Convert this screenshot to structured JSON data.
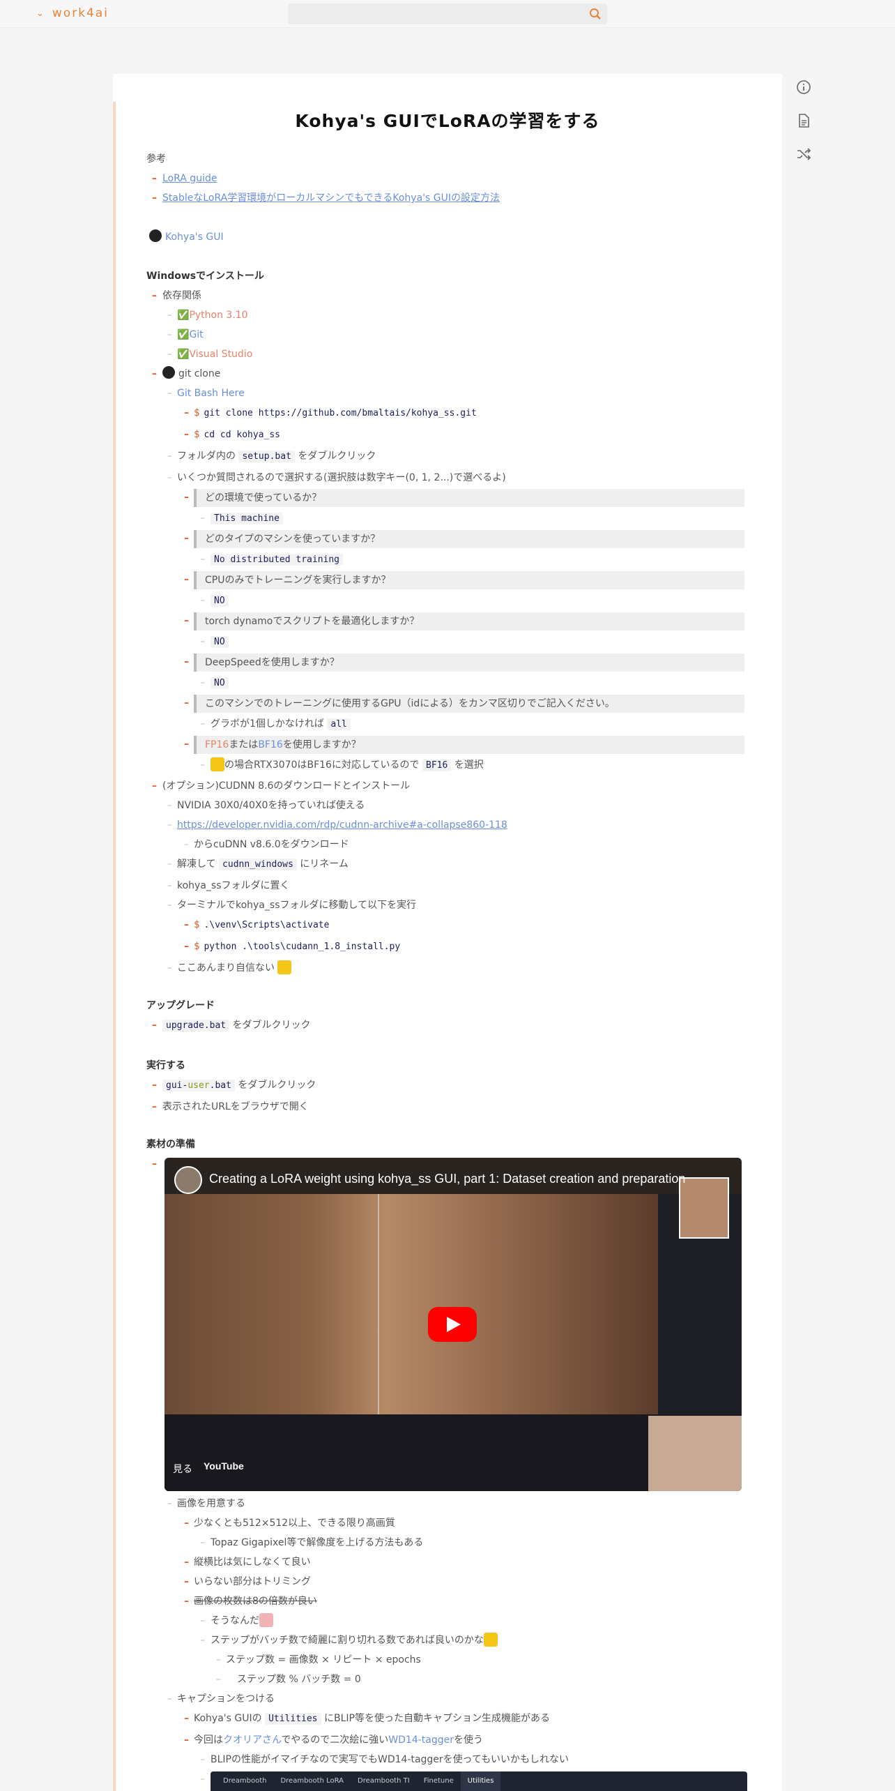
{
  "app": {
    "brand": "work4ai",
    "search_placeholder": ""
  },
  "page": {
    "title": "Kohya's GUIでLoRAの学習をする"
  },
  "refs": {
    "label": "参考",
    "link1": "LoRA guide",
    "link2": "StableなLoRA学習環境がローカルマシンでもできるKohya's GUIの設定方法",
    "github": "Kohya's GUI"
  },
  "install": {
    "heading": "Windowsでインストール",
    "deps": "依存関係",
    "python": "Python 3.10",
    "git": "Git",
    "vs": "Visual Studio",
    "git_clone": "git clone",
    "git_bash": "Git Bash Here",
    "cmd1": "git clone https://github.com/bmaltais/kohya_ss.git",
    "cmd2": "cd cd kohya_ss",
    "setup_pre": "フォルダ内の",
    "setup_code": "setup.bat",
    "setup_post": "をダブルクリック",
    "questions": "いくつか質問されるので選択する(選択肢は数字キー(0, 1, 2...)で選べるよ)",
    "q1": "どの環境で使っているか？",
    "a1": "This machine",
    "q2": "どのタイプのマシンを使っていますか？",
    "a2": "No distributed training",
    "q3": "CPUのみでトレーニングを実行しますか？",
    "a3": "NO",
    "q4": "torch dynamoでスクリプトを最適化しますか？",
    "a4": "NO",
    "q5": "DeepSpeedを使用しますか？",
    "a5": "NO",
    "q6": "このマシンでのトレーニングに使用するGPU（idによる）をカンマ区切りでご記入ください。",
    "a6_pre": "グラボが1個しかなければ",
    "a6_code": "all",
    "q7_fp": "FP16",
    "q7_mid": "または",
    "q7_bf": "BF16",
    "q7_post": "を使用しますか？",
    "a7_pre": "の場合RTX3070はBF16に対応しているので",
    "a7_code": "BF16",
    "a7_post": "を選択",
    "cudnn": "(オプション)CUDNN 8.6のダウンロードとインストール",
    "nvidia": "NVIDIA 30X0/40X0を持っていれば使える",
    "nvidia_link": "https://developer.nvidia.com/rdp/cudnn-archive#a-collapse860-118",
    "cudnn_dl": "からcuDNN v8.6.0をダウンロード",
    "unzip_pre": "解凍して",
    "unzip_code": "cudnn_windows",
    "unzip_post": "にリネーム",
    "place": "kohya_ssフォルダに置く",
    "terminal": "ターミナルでkohya_ssフォルダに移動して以下を実行",
    "cmd3": ".\\venv\\Scripts\\activate",
    "cmd4": "python .\\tools\\cudann_1.8_install.py",
    "unsure": "ここあんまり自信ない"
  },
  "upgrade": {
    "heading": "アップグレード",
    "code": "upgrade.bat",
    "post": "をダブルクリック"
  },
  "run": {
    "heading": "実行する",
    "code_a": "gui-",
    "code_b": "user",
    "code_c": ".bat",
    "post": "をダブルクリック",
    "open": "表示されたURLをブラウザで開く"
  },
  "material": {
    "heading": "素材の準備",
    "video_title": "Creating a LoRA weight using kohya_ss GUI, part 1: Dataset creation and preparation",
    "watch": "見る",
    "youtube": "YouTube",
    "images": "画像を用意する",
    "m1": "少なくとも512×512以上、できる限り高画質",
    "m2": "Topaz Gigapixel等で解像度を上げる方法もある",
    "m3": "縦横比は気にしなくて良い",
    "m4": "いらない部分はトリミング",
    "m5": "画像の枚数は8の倍数が良い",
    "m6": "そうなんだ",
    "m7": "ステップがバッチ数で綺麗に割り切れる数であれば良いのかな",
    "m8": "ステップ数 = 画像数 × リピート × epochs",
    "m9": "ステップ数 % バッチ数 = 0",
    "caption": "キャプションをつける",
    "c1_pre": "Kohya's GUIの",
    "c1_code": "Utilities",
    "c1_post": "にBLIP等を使った自動キャプション生成機能がある",
    "c2_pre": "今回は",
    "c2_link": "クオリアさん",
    "c2_mid": "でやるので二次絵に強い",
    "c2_link2": "WD14-tagger",
    "c2_post": "を使う",
    "c3": "BLIPの性能がイマイチなので実写でもWD14-taggerを使ってもいいかもしれない"
  },
  "tabs": [
    "Dreambooth",
    "Dreambooth LoRA",
    "Dreambooth TI",
    "Finetune",
    "Utilities"
  ]
}
